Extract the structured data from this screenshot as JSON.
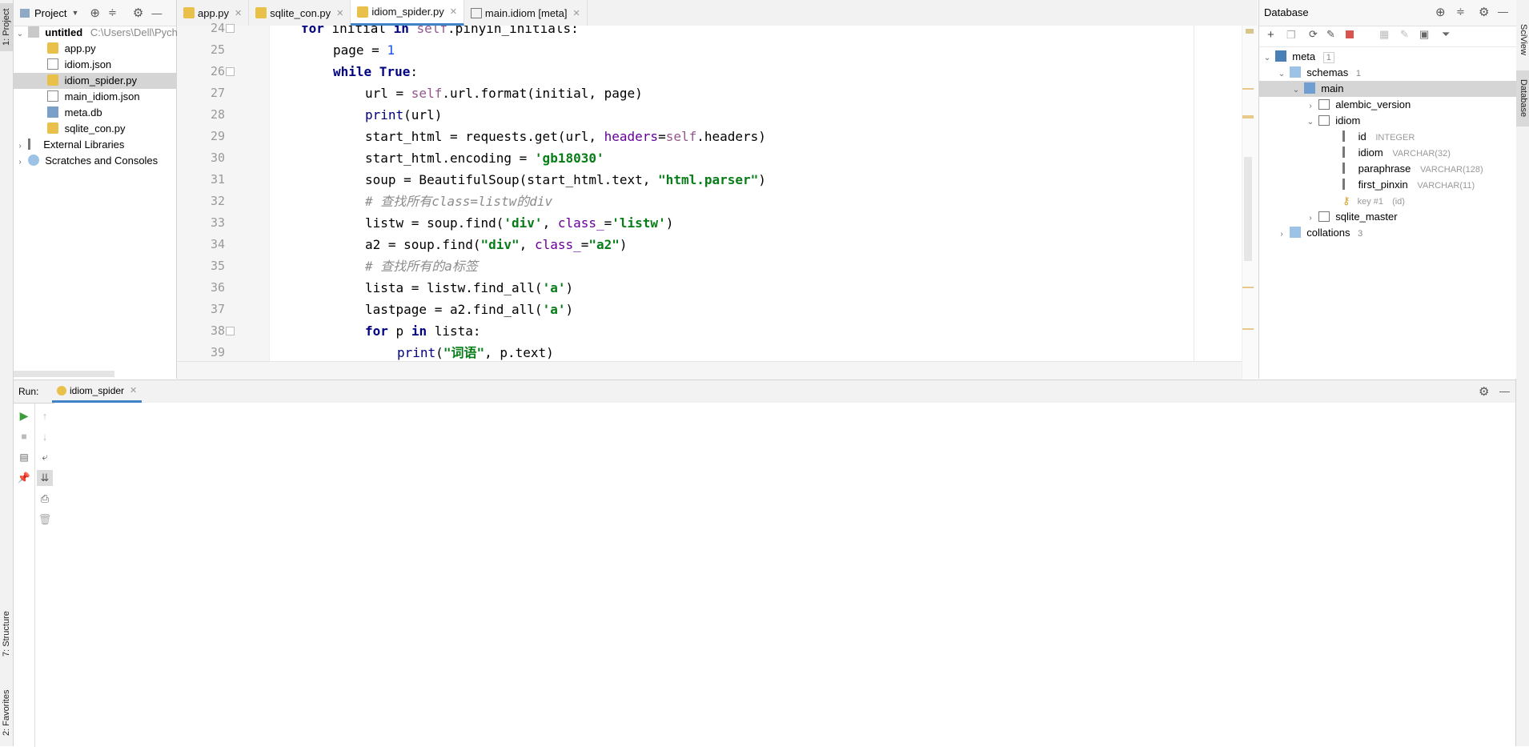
{
  "left_strip": {
    "project_tab": "1: Project",
    "structure_tab": "7: Structure",
    "favorites_tab": "2: Favorites"
  },
  "right_strip": {
    "sciview_tab": "SciView",
    "database_tab": "Database"
  },
  "project": {
    "header_label": "Project",
    "root": {
      "name": "untitled",
      "path": "C:\\Users\\Dell\\Pych"
    },
    "files": [
      "app.py",
      "idiom.json",
      "idiom_spider.py",
      "main_idiom.json",
      "meta.db",
      "sqlite_con.py"
    ],
    "selected_file": "idiom_spider.py",
    "external_libraries": "External Libraries",
    "scratches": "Scratches and Consoles"
  },
  "editor": {
    "tabs": [
      {
        "label": "app.py",
        "icon": "python-file-icon"
      },
      {
        "label": "sqlite_con.py",
        "icon": "python-file-icon"
      },
      {
        "label": "idiom_spider.py",
        "icon": "python-file-icon"
      },
      {
        "label": "main.idiom [meta]",
        "icon": "table-icon"
      }
    ],
    "active_tab": "idiom_spider.py",
    "line_numbers": [
      "24",
      "25",
      "26",
      "27",
      "28",
      "29",
      "30",
      "31",
      "32",
      "33",
      "34",
      "35",
      "36",
      "37",
      "38",
      "39"
    ],
    "lines": [
      "for initial in self.pinyin_initials:",
      "page = 1",
      "while True:",
      "url = self.url.format(initial, page)",
      "print(url)",
      "start_html = requests.get(url, headers=self.headers)",
      "start_html.encoding = 'gb18030'",
      "soup = BeautifulSoup(start_html.text, \"html.parser\")",
      "# 查找所有class=listw的div",
      "listw = soup.find('div', class_='listw')",
      "a2 = soup.find(\"div\", class_=\"a2\")",
      "# 查找所有的a标签",
      "lista = listw.find_all('a')",
      "lastpage = a2.find_all('a')",
      "for p in lista:",
      "print(\"词语\", p.text)"
    ]
  },
  "database": {
    "title": "Database",
    "meta": {
      "label": "meta",
      "count": "1"
    },
    "schemas": {
      "label": "schemas",
      "count": "1"
    },
    "main": "main",
    "alembic_version": "alembic_version",
    "idiom_table": "idiom",
    "columns": [
      {
        "name": "id",
        "type": "INTEGER"
      },
      {
        "name": "idiom",
        "type": "VARCHAR(32)"
      },
      {
        "name": "paraphrase",
        "type": "VARCHAR(128)"
      },
      {
        "name": "first_pinxin",
        "type": "VARCHAR(11)"
      }
    ],
    "key": {
      "name": "key #1",
      "cols": "(id)"
    },
    "sqlite_master": "sqlite_master",
    "collations": {
      "label": "collations",
      "count": "3"
    }
  },
  "run": {
    "label": "Run:",
    "config_name": "idiom_spider"
  },
  "colors": {
    "accent": "#4083c9",
    "keyword": "#000080",
    "string": "#067d17",
    "self": "#94558d",
    "number": "#1750eb",
    "comment": "#8c8c8c"
  }
}
